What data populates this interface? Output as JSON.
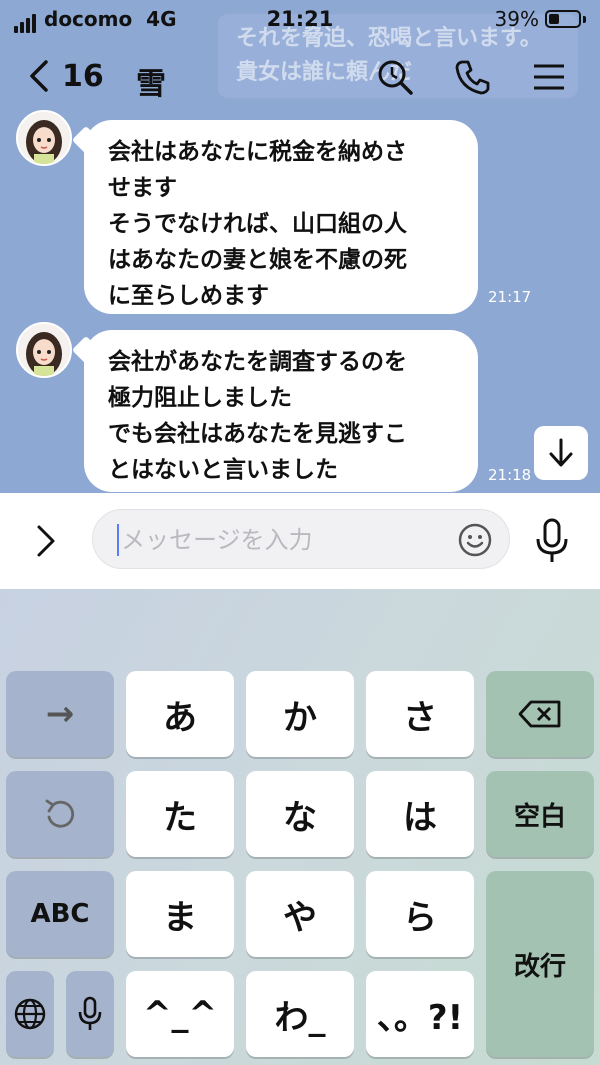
{
  "status": {
    "carrier": "docomo",
    "network": "4G",
    "time": "21:21",
    "battery": "39%"
  },
  "ghost_text": "それを脅迫、恐喝と言います。貴女は誰に頼んだ",
  "header": {
    "unread_count": "16",
    "contact_name": "雪"
  },
  "messages": [
    {
      "lines": [
        "会社はあなたに税金を納めさ",
        "せます",
        "そうでなければ、山口組の人",
        "はあなたの妻と娘を不慮の死",
        "に至らしめます"
      ],
      "time": "21:17"
    },
    {
      "lines": [
        "会社があなたを調査するのを",
        "極力阻止しました",
        "でも会社はあなたを見逃すこ",
        "とはないと言いました"
      ],
      "time": "21:18"
    }
  ],
  "input": {
    "placeholder": "メッセージを入力",
    "value": ""
  },
  "keyboard": {
    "row1": [
      "→",
      "あ",
      "か",
      "さ",
      "⌫"
    ],
    "row2": [
      "↺",
      "た",
      "な",
      "は",
      "空白"
    ],
    "row3": [
      "ABC",
      "ま",
      "や",
      "ら",
      "改行"
    ],
    "row4": [
      "🌐",
      "🎤",
      "^_^",
      "わ_",
      "、。?!"
    ]
  }
}
